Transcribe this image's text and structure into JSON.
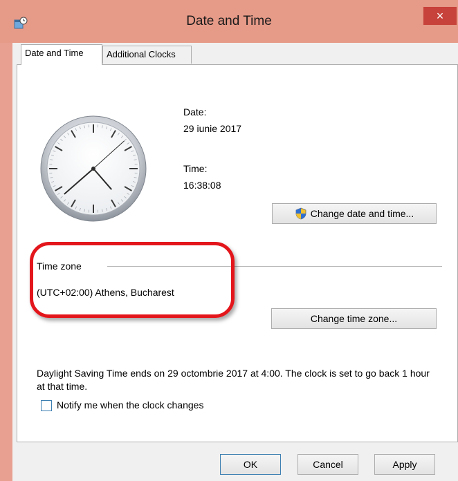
{
  "window": {
    "title": "Date and Time",
    "close_glyph": "×"
  },
  "tabs": [
    {
      "label": "Date and Time",
      "active": true
    },
    {
      "label": "Additional Clocks",
      "active": false
    }
  ],
  "clock": {
    "time_shown": "16:38:08"
  },
  "date": {
    "label": "Date:",
    "value": "29 iunie 2017"
  },
  "time": {
    "label": "Time:",
    "value": "16:38:08"
  },
  "buttons": {
    "change_date_time": "Change date and time...",
    "change_time_zone": "Change time zone...",
    "ok": "OK",
    "cancel": "Cancel",
    "apply": "Apply"
  },
  "time_zone": {
    "heading": "Time zone",
    "value": "(UTC+02:00) Athens, Bucharest"
  },
  "dst": {
    "text": "Daylight Saving Time ends on 29 octombrie 2017 at 4:00. The clock is set to go back 1 hour at that time."
  },
  "notify": {
    "label": "Notify me when the clock changes",
    "checked": false
  },
  "colors": {
    "title_bar": "#e69a88",
    "close_button": "#c7423a",
    "highlight": "#e3161c",
    "accent": "#3c7fb1"
  }
}
